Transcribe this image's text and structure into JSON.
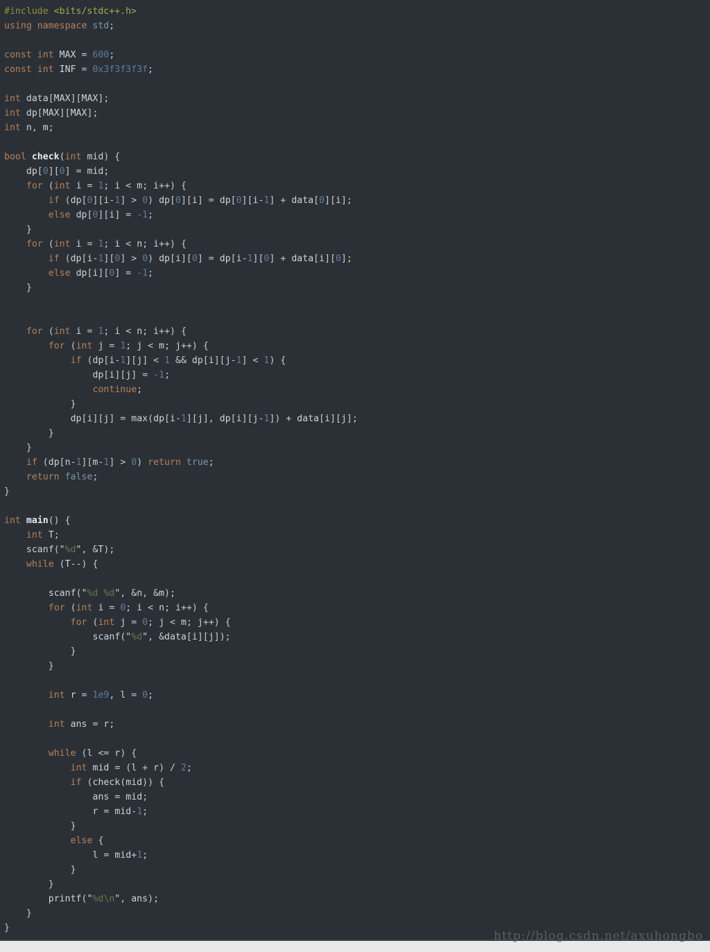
{
  "editor": {
    "language": "C++",
    "background_color": "#2b3036",
    "default_text_color": "#d8dce0",
    "font_size_px": 13,
    "line_height_px": 21,
    "theme_colors": {
      "preprocessor": "#8f8f3d",
      "header_path": "#a9a94f",
      "keyword": "#b5825a",
      "number": "#5c7d9c",
      "string": "#5f7a46",
      "function_name": "#e6e9ec",
      "constant": "#7e95a8",
      "plain": "#cfd4d8"
    }
  },
  "watermark": {
    "text": "http://blog.csdn.net/axuhongbo",
    "color": "#5d646c"
  },
  "code": {
    "lines": [
      "#include <bits/stdc++.h>",
      "using namespace std;",
      "",
      "const int MAX = 600;",
      "const int INF = 0x3f3f3f3f;",
      "",
      "int data[MAX][MAX];",
      "int dp[MAX][MAX];",
      "int n, m;",
      "",
      "bool check(int mid) {",
      "    dp[0][0] = mid;",
      "    for (int i = 1; i < m; i++) {",
      "        if (dp[0][i-1] > 0) dp[0][i] = dp[0][i-1] + data[0][i];",
      "        else dp[0][i] = -1;",
      "    }",
      "    for (int i = 1; i < n; i++) {",
      "        if (dp[i-1][0] > 0) dp[i][0] = dp[i-1][0] + data[i][0];",
      "        else dp[i][0] = -1;",
      "    }",
      "",
      "",
      "    for (int i = 1; i < n; i++) {",
      "        for (int j = 1; j < m; j++) {",
      "            if (dp[i-1][j] < 1 && dp[i][j-1] < 1) {",
      "                dp[i][j] = -1;",
      "                continue;",
      "            }",
      "            dp[i][j] = max(dp[i-1][j], dp[i][j-1]) + data[i][j];",
      "        }",
      "    }",
      "    if (dp[n-1][m-1] > 0) return true;",
      "    return false;",
      "}",
      "",
      "int main() {",
      "    int T;",
      "    scanf(\"%d\", &T);",
      "    while (T--) {",
      "",
      "        scanf(\"%d %d\", &n, &m);",
      "        for (int i = 0; i < n; i++) {",
      "            for (int j = 0; j < m; j++) {",
      "                scanf(\"%d\", &data[i][j]);",
      "            }",
      "        }",
      "",
      "        int r = 1e9, l = 0;",
      "",
      "        int ans = r;",
      "",
      "        while (l <= r) {",
      "            int mid = (l + r) / 2;",
      "            if (check(mid)) {",
      "                ans = mid;",
      "                r = mid-1;",
      "            }",
      "            else {",
      "                l = mid+1;",
      "            }",
      "        }",
      "        printf(\"%d\\n\", ans);",
      "    }",
      "}"
    ]
  }
}
